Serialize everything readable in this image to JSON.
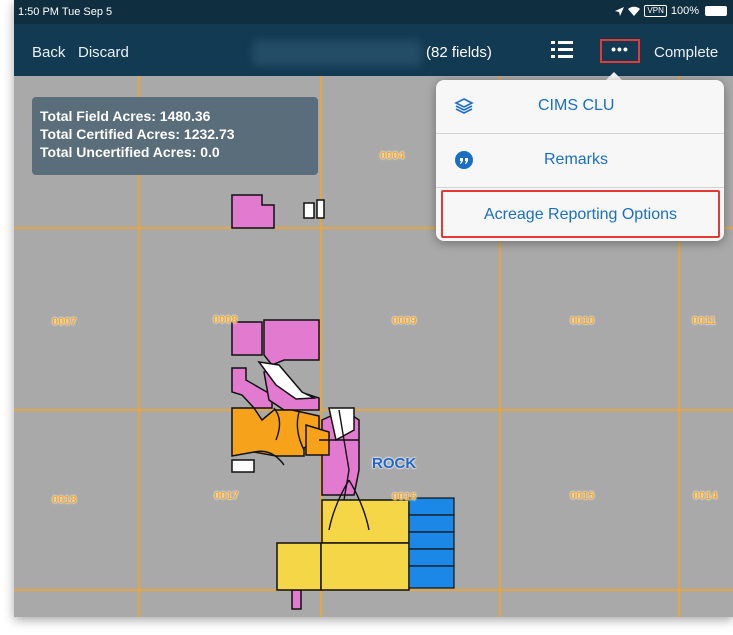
{
  "status_bar": {
    "time": "1:50 PM  Tue Sep 5",
    "vpn": "VPN",
    "battery": "100%"
  },
  "nav": {
    "back_label": "Back",
    "discard_label": "Discard",
    "field_count": "(82 fields)",
    "more_label": "•••",
    "complete_label": "Complete"
  },
  "summary": {
    "total_field_acres": "Total Field Acres: 1480.36",
    "total_certified_acres": "Total Certified Acres: 1232.73",
    "total_uncertified_acres": "Total Uncertified Acres: 0.0"
  },
  "map": {
    "section_labels": [
      "0004",
      "0007",
      "0008",
      "0009",
      "0010",
      "0011",
      "0018",
      "0017",
      "0016",
      "0015",
      "0014"
    ],
    "place_label": "ROCK",
    "colors": {
      "grid_line": "#f5a623",
      "background": "#a9a9a9",
      "pink": "#e27bd0",
      "orange": "#f7a21b",
      "yellow": "#f4d646",
      "blue": "#1b87e6"
    }
  },
  "menu": {
    "items": [
      {
        "label": "CIMS CLU",
        "icon": "layers-icon"
      },
      {
        "label": "Remarks",
        "icon": "quote-bubble-icon"
      },
      {
        "label": "Acreage Reporting Options",
        "icon": ""
      }
    ]
  }
}
